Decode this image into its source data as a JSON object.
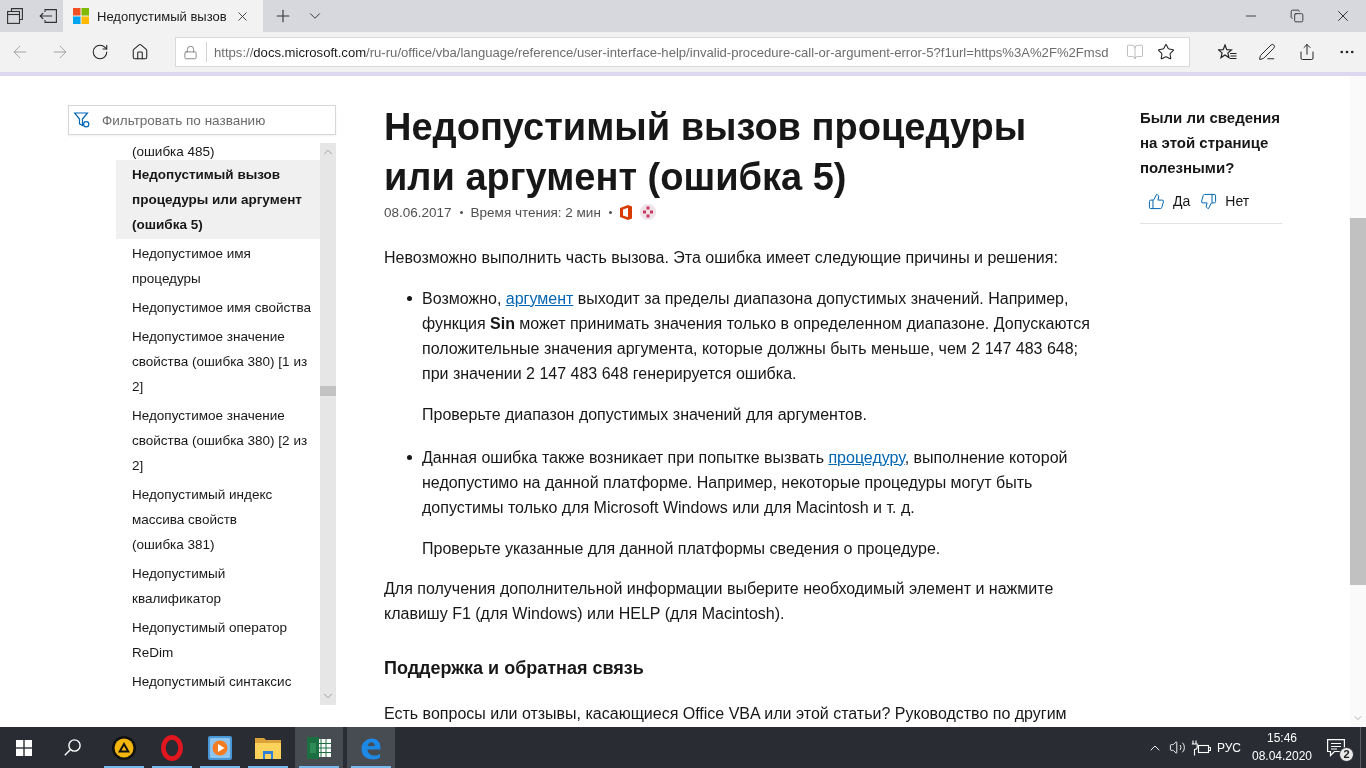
{
  "browser": {
    "tabs": [
      {
        "title": "Недопустимый вызов",
        "selected": true
      }
    ],
    "address": {
      "scheme": "https://",
      "host": "docs.microsoft.com",
      "path": "/ru-ru/office/vba/language/reference/user-interface-help/invalid-procedure-call-or-argument-error-5?f1url=https%3A%2F%2Fmsd"
    }
  },
  "sidebar": {
    "filter_placeholder": "Фильтровать по названию",
    "items": [
      {
        "label": "(ошибка 485)",
        "selected": false
      },
      {
        "label": "Недопустимый вызов процедуры или аргумент (ошибка 5)",
        "selected": true
      },
      {
        "label": "Недопустимое имя процедуры",
        "selected": false
      },
      {
        "label": "Недопустимое имя свойства",
        "selected": false
      },
      {
        "label": "Недопустимое значение свойства (ошибка 380) [1 из 2]",
        "selected": false
      },
      {
        "label": "Недопустимое значение свойства (ошибка 380) [2 из 2]",
        "selected": false
      },
      {
        "label": "Недопустимый индекс массива свойств (ошибка 381)",
        "selected": false
      },
      {
        "label": "Недопустимый квалификатор",
        "selected": false
      },
      {
        "label": "Недопустимый оператор ReDim",
        "selected": false
      },
      {
        "label": "Недопустимый синтаксис",
        "selected": false
      }
    ]
  },
  "article": {
    "title": "Недопустимый вызов процедуры или аргумент (ошибка 5)",
    "meta": [
      "08.06.2017",
      "Время чтения: 2 мин"
    ],
    "intro": "Невозможно выполнить часть вызова. Эта ошибка имеет следующие причины и решения:",
    "causes": [
      {
        "text": [
          {
            "kind": "text",
            "text": "Возможно, "
          },
          {
            "kind": "link",
            "text": "аргумент"
          },
          {
            "kind": "text",
            "text": " выходит за пределы диапазона допустимых значений. Например, функция **Sin** может принимать значения только в определенном диапазоне. Допускаются положительные значения аргумента, которые должны быть меньше, чем 2 147 483 648; при значении 2 147 483 648 генерируется ошибка."
          }
        ],
        "advice": "Проверьте диапазон допустимых значений для аргументов."
      },
      {
        "text": [
          {
            "kind": "text",
            "text": "Данная ошибка также возникает при попытке вызвать "
          },
          {
            "kind": "link",
            "text": "процедуру"
          },
          {
            "kind": "text",
            "text": ", выполнение которой недопустимо на данной платформе. Например, некоторые процедуры могут быть допустимы только для Microsoft Windows или для Macintosh и т. д."
          }
        ],
        "advice": "Проверьте указанные для данной платформы сведения о процедуре."
      }
    ],
    "closing": "Для получения дополнительной информации выберите необходимый элемент и нажмите клавишу F1 (для Windows) или HELP (для Macintosh).",
    "support": {
      "heading": "Поддержка и обратная связь",
      "text": "Есть вопросы или отзывы, касающиеся Office VBA или этой статьи? Руководство по другим"
    }
  },
  "feedback": {
    "question": "Были ли сведения на этой странице полезными?",
    "buttons": [
      {
        "kind": "up",
        "label": "Да"
      },
      {
        "kind": "down",
        "label": "Нет"
      }
    ]
  },
  "taskbar": {
    "apps": [
      {
        "kind": "triangle",
        "running": true,
        "highlighted": false
      },
      {
        "kind": "ring",
        "running": true,
        "highlighted": false
      },
      {
        "kind": "player",
        "running": true,
        "highlighted": false
      },
      {
        "kind": "folder",
        "running": true,
        "highlighted": false
      },
      {
        "kind": "sheet",
        "running": true,
        "highlighted": true
      },
      {
        "kind": "swirl",
        "running": true,
        "highlighted": true
      }
    ],
    "language": "РУС",
    "time": "15:46",
    "date": "08.04.2020",
    "notifications": "2"
  }
}
